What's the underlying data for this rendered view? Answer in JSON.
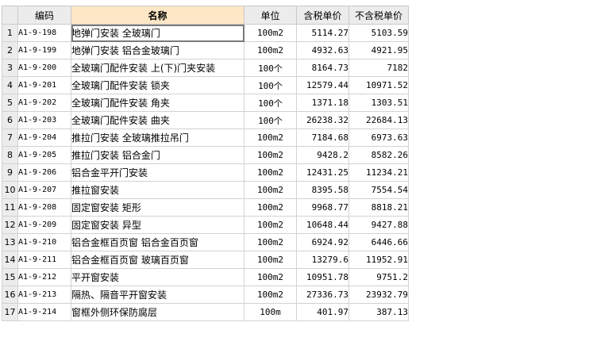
{
  "headers": {
    "code": "编码",
    "name": "名称",
    "unit": "单位",
    "price_tax": "含税单价",
    "price_notax": "不含税单价"
  },
  "rows": [
    {
      "n": "1",
      "code": "A1-9-198",
      "name": "地弹门安装 全玻璃门",
      "unit": "100m2",
      "tax": "5114.27",
      "notax": "5103.59"
    },
    {
      "n": "2",
      "code": "A1-9-199",
      "name": "地弹门安装 铝合金玻璃门",
      "unit": "100m2",
      "tax": "4932.63",
      "notax": "4921.95"
    },
    {
      "n": "3",
      "code": "A1-9-200",
      "name": "全玻璃门配件安装 上(下)门夹安装",
      "unit": "100个",
      "tax": "8164.73",
      "notax": "7182"
    },
    {
      "n": "4",
      "code": "A1-9-201",
      "name": "全玻璃门配件安装 锁夹",
      "unit": "100个",
      "tax": "12579.44",
      "notax": "10971.52"
    },
    {
      "n": "5",
      "code": "A1-9-202",
      "name": "全玻璃门配件安装 角夹",
      "unit": "100个",
      "tax": "1371.18",
      "notax": "1303.51"
    },
    {
      "n": "6",
      "code": "A1-9-203",
      "name": "全玻璃门配件安装 曲夹",
      "unit": "100个",
      "tax": "26238.32",
      "notax": "22684.13"
    },
    {
      "n": "7",
      "code": "A1-9-204",
      "name": "推拉门安装 全玻璃推拉吊门",
      "unit": "100m2",
      "tax": "7184.68",
      "notax": "6973.63"
    },
    {
      "n": "8",
      "code": "A1-9-205",
      "name": "推拉门安装 铝合金门",
      "unit": "100m2",
      "tax": "9428.2",
      "notax": "8582.26"
    },
    {
      "n": "9",
      "code": "A1-9-206",
      "name": "铝合金平开门安装",
      "unit": "100m2",
      "tax": "12431.25",
      "notax": "11234.21"
    },
    {
      "n": "10",
      "code": "A1-9-207",
      "name": "推拉窗安装",
      "unit": "100m2",
      "tax": "8395.58",
      "notax": "7554.54"
    },
    {
      "n": "11",
      "code": "A1-9-208",
      "name": "固定窗安装 矩形",
      "unit": "100m2",
      "tax": "9968.77",
      "notax": "8818.21"
    },
    {
      "n": "12",
      "code": "A1-9-209",
      "name": "固定窗安装 异型",
      "unit": "100m2",
      "tax": "10648.44",
      "notax": "9427.88"
    },
    {
      "n": "13",
      "code": "A1-9-210",
      "name": "铝合金框百页窗 铝合金百页窗",
      "unit": "100m2",
      "tax": "6924.92",
      "notax": "6446.66"
    },
    {
      "n": "14",
      "code": "A1-9-211",
      "name": "铝合金框百页窗 玻璃百页窗",
      "unit": "100m2",
      "tax": "13279.6",
      "notax": "11952.91"
    },
    {
      "n": "15",
      "code": "A1-9-212",
      "name": "平开窗安装",
      "unit": "100m2",
      "tax": "10951.78",
      "notax": "9751.2"
    },
    {
      "n": "16",
      "code": "A1-9-213",
      "name": "隔热、隔音平开窗安装",
      "unit": "100m2",
      "tax": "27336.73",
      "notax": "23932.79"
    },
    {
      "n": "17",
      "code": "A1-9-214",
      "name": "窗框外侧环保防腐层",
      "unit": "100m",
      "tax": "401.97",
      "notax": "387.13"
    }
  ]
}
